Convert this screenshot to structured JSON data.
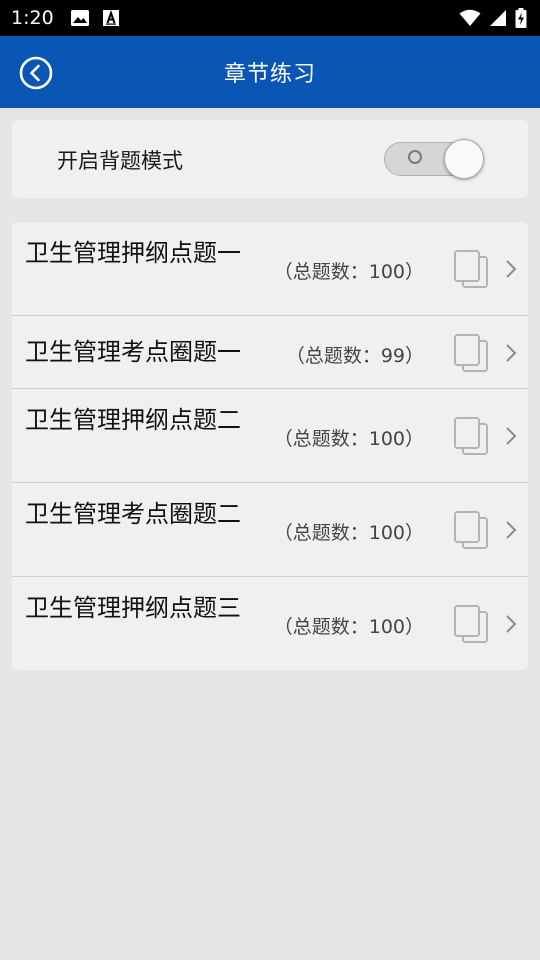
{
  "status_bar": {
    "time": "1:20",
    "icons": [
      "image-icon",
      "font-a-icon",
      "wifi-icon",
      "signal-icon",
      "battery-charging-icon"
    ]
  },
  "header": {
    "title": "章节练习",
    "back_icon": "back-circle-icon",
    "background": "#0a56b4"
  },
  "settings": {
    "recite_mode_label": "开启背题模式",
    "recite_mode_on": false
  },
  "chapters": [
    {
      "title": "卫生管理押纲点题一",
      "count": "（总题数：100）"
    },
    {
      "title": "卫生管理考点圈题一",
      "count": "（总题数：99）"
    },
    {
      "title": "卫生管理押纲点题二",
      "count": "（总题数：100）"
    },
    {
      "title": "卫生管理考点圈题二",
      "count": "（总题数：100）"
    },
    {
      "title": "卫生管理押纲点题三",
      "count": "（总题数：100）"
    }
  ]
}
